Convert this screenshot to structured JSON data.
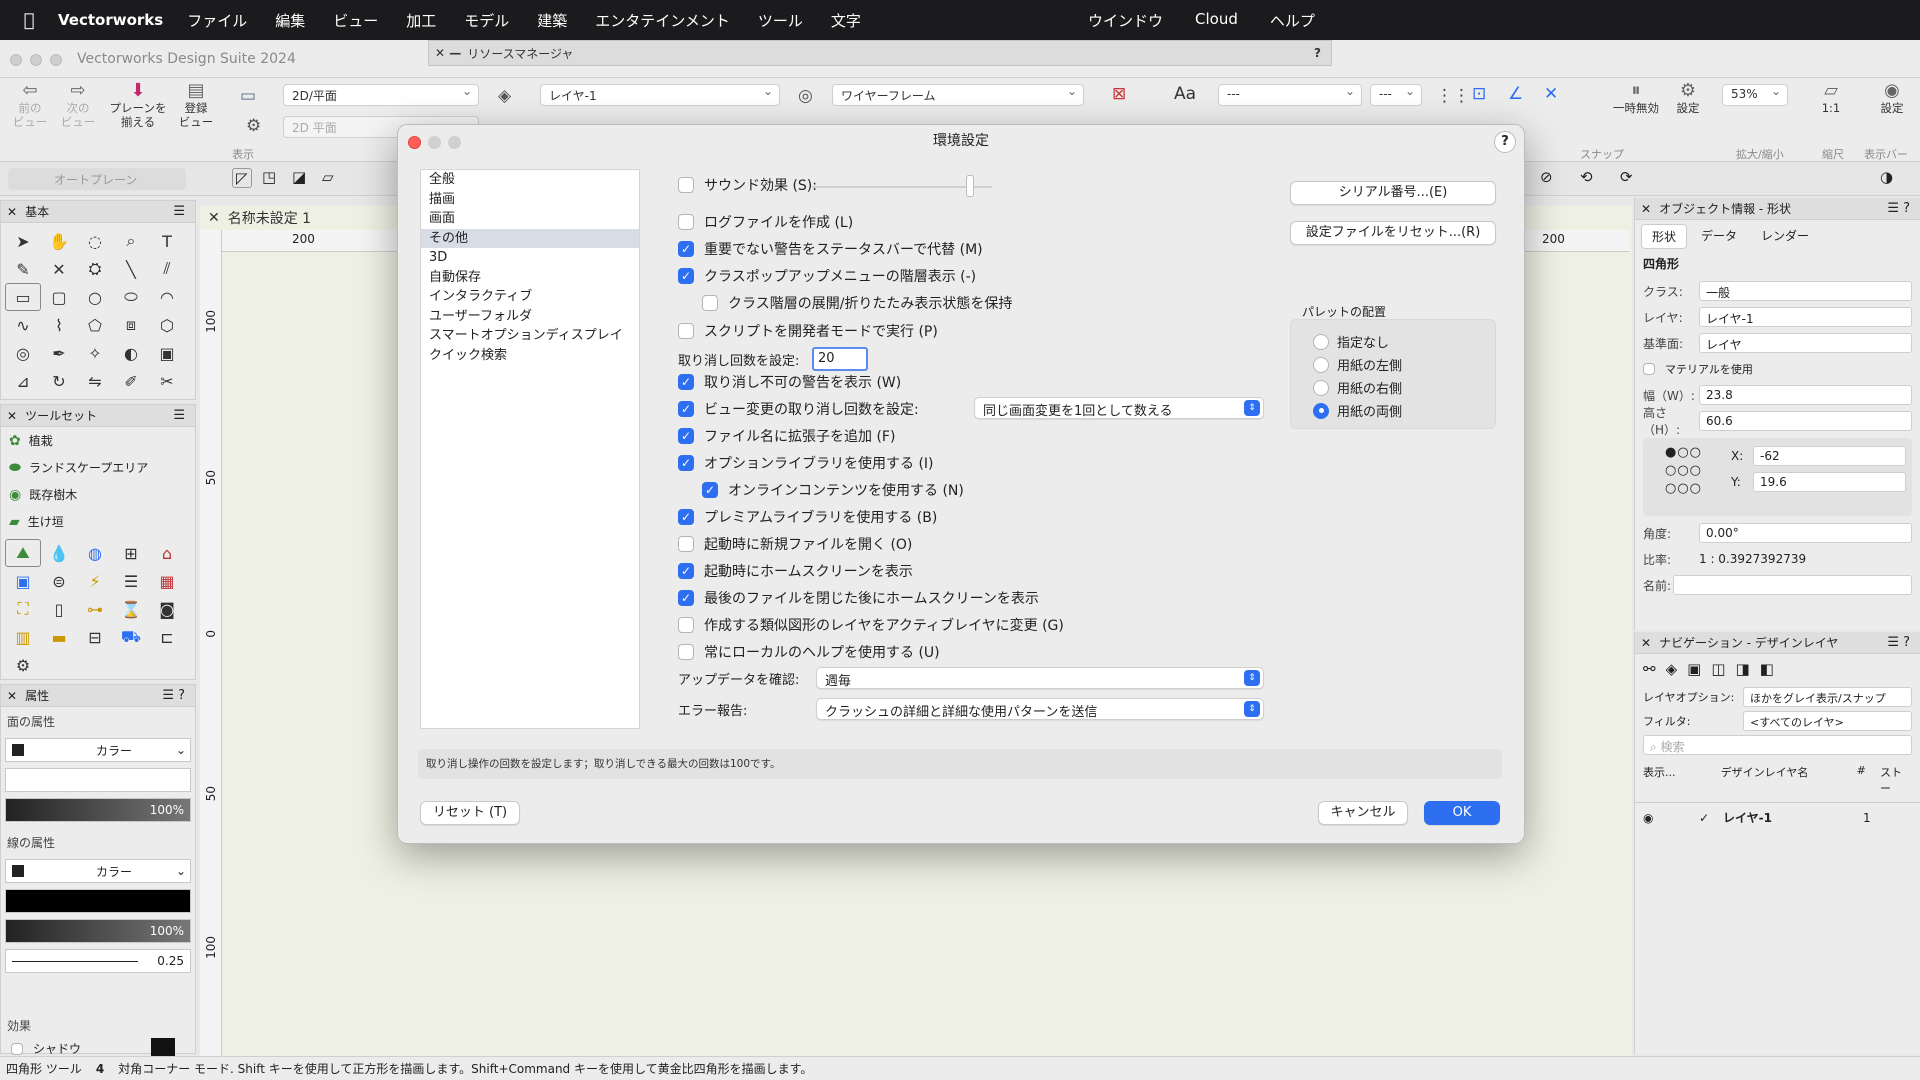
{
  "menubar": {
    "app": "Vectorworks",
    "items": [
      "ファイル",
      "編集",
      "ビュー",
      "加工",
      "モデル",
      "建築",
      "エンタテインメント",
      "ツール",
      "文字"
    ],
    "right_items": [
      "ウインドウ",
      "Cloud",
      "ヘルプ"
    ]
  },
  "window": {
    "title": "Vectorworks Design Suite 2024",
    "resource_manager": "リソースマネージャ"
  },
  "toolbar": {
    "prev_view": "前の\nビュー",
    "next_view": "次の\nビュー",
    "plane_switch": "プレーンを\n揃える",
    "saved_view": "登録\nビュー",
    "view_select": "2D/平面",
    "view_select2": "2D 平面",
    "layer_select": "レイヤ-1",
    "render_select": "ワイヤーフレーム",
    "font_select": "---",
    "size_select": "---",
    "zoom": "53%",
    "pause_label": "一時無効",
    "settings_label": "設定",
    "scale_label": "1:1",
    "settings_label2": "設定",
    "label_view": "表示",
    "label_snap": "スナップ",
    "label_zoom": "拡大/縮小",
    "label_scale": "縮尺",
    "label_display_bar": "表示バー",
    "auto_plane": "オートプレーン"
  },
  "palettes": {
    "basic_title": "基本",
    "toolset_title": "ツールセット",
    "toolsets": [
      "植栽",
      "ランドスケープエリア",
      "既存樹木",
      "生け垣"
    ],
    "attr_title": "属性",
    "fill_label": "面の属性",
    "fill_value": "カラー",
    "fill_opacity": "100%",
    "line_label": "線の属性",
    "line_value": "カラー",
    "line_opacity": "100%",
    "line_weight": "0.25",
    "effects_label": "効果",
    "shadow_label": "シャドウ"
  },
  "document": {
    "tab": "名称未設定 1",
    "ruler_h": [
      "200",
      "200"
    ],
    "ruler_v": [
      "100",
      "50",
      "0",
      "50",
      "100"
    ]
  },
  "object_info": {
    "title": "オブジェクト情報 - 形状",
    "tabs": [
      "形状",
      "データ",
      "レンダー"
    ],
    "type": "四角形",
    "class_label": "クラス:",
    "class_value": "一般",
    "layer_label": "レイヤ:",
    "layer_value": "レイヤ-1",
    "plane_label": "基準面:",
    "plane_value": "レイヤ",
    "material_label": "マテリアルを使用",
    "width_label": "幅（W）:",
    "width_value": "23.8",
    "height_label": "高さ（H）:",
    "height_value": "60.6",
    "x_label": "X:",
    "x_value": "-62",
    "y_label": "Y:",
    "y_value": "19.6",
    "angle_label": "角度:",
    "angle_value": "0.00°",
    "ratio_label": "比率:",
    "ratio_value": "1 : 0.3927392739",
    "name_label": "名前:"
  },
  "navigation": {
    "title": "ナビゲーション - デザインレイヤ",
    "layer_option_label": "レイヤオプション:",
    "layer_option_value": "ほかをグレイ表示/スナップ",
    "filter_label": "フィルタ:",
    "filter_value": "<すべてのレイヤ>",
    "search_placeholder": "検索",
    "col_show": "表示...",
    "col_name": "デザインレイヤ名",
    "col_num": "#",
    "col_story": "ストー",
    "row_name": "レイヤ-1",
    "row_num": "1"
  },
  "status": {
    "tool": "四角形 ツール",
    "mode": "4",
    "hint": "対角コーナー モード. Shift キーを使用して正方形を描画します。Shift+Command キーを使用して黄金比四角形を描画します。"
  },
  "dialog": {
    "title": "環境設定",
    "categories": [
      "全般",
      "描画",
      "画面",
      "その他",
      "3D",
      "自動保存",
      "インタラクティブ",
      "ユーザーフォルダ",
      "スマートオプションディスプレイ",
      "クイック検索"
    ],
    "selected_category": "その他",
    "opt_sound": "サウンド効果 (S):",
    "opt_log": "ログファイルを作成 (L)",
    "opt_minor_warn": "重要でない警告をステータスバーで代替 (M)",
    "opt_class_popup": "クラスポップアップメニューの階層表示 (-)",
    "opt_keep_expand": "クラス階層の展開/折りたたみ表示状態を保持",
    "opt_script_dev": "スクリプトを開発者モードで実行 (P)",
    "undo_label": "取り消し回数を設定:",
    "undo_value": "20",
    "opt_undo_warn": "取り消し不可の警告を表示 (W)",
    "opt_view_undo": "ビュー変更の取り消し回数を設定:",
    "view_undo_value": "同じ画面変更を1回として数える",
    "opt_ext": "ファイル名に拡張子を追加 (F)",
    "opt_option_lib": "オプションライブラリを使用する (I)",
    "opt_online": "オンラインコンテンツを使用する (N)",
    "opt_premium": "プレミアムライブラリを使用する (B)",
    "opt_new_file": "起動時に新規ファイルを開く (O)",
    "opt_home_start": "起動時にホームスクリーンを表示",
    "opt_home_close": "最後のファイルを閉じた後にホームスクリーンを表示",
    "opt_similar_layer": "作成する類似図形のレイヤをアクティブレイヤに変更 (G)",
    "opt_local_help": "常にローカルのヘルプを使用する (U)",
    "update_label": "アップデータを確認:",
    "update_value": "週毎",
    "error_label": "エラー報告:",
    "error_value": "クラッシュの詳細と詳細な使用パターンを送信",
    "serial_btn": "シリアル番号...(E)",
    "reset_file_btn": "設定ファイルをリセット...(R)",
    "palette_title": "パレットの配置",
    "palette_opts": [
      "指定なし",
      "用紙の左側",
      "用紙の右側",
      "用紙の両側"
    ],
    "palette_selected": 3,
    "description": "取り消し操作の回数を設定します；取り消しできる最大の回数は100です。",
    "reset_btn": "リセット (T)",
    "cancel_btn": "キャンセル",
    "ok_btn": "OK"
  }
}
